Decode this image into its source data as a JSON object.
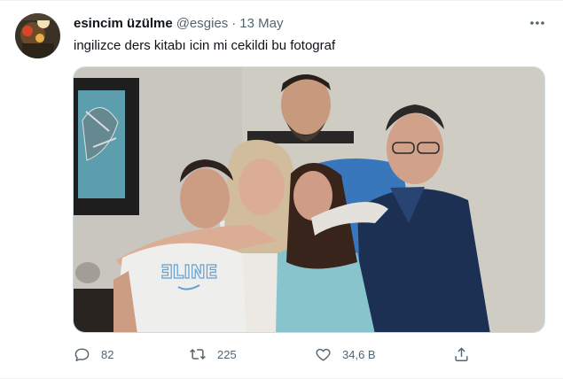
{
  "tweet": {
    "display_name": "esincim üzülme",
    "handle": "@esgies",
    "separator": "·",
    "time": "13 May",
    "text": "ingilizce ders kitabı icin mi cekildi bu fotograf"
  },
  "actions": {
    "reply_count": "82",
    "retweet_count": "225",
    "like_count": "34,6 B"
  },
  "icons": {
    "more": "more-horizontal-icon",
    "reply": "reply-icon",
    "retweet": "retweet-icon",
    "like": "heart-icon",
    "share": "share-icon"
  },
  "media": {
    "tshirt_text": "ƎLINE"
  },
  "colors": {
    "text_primary": "#0f1419",
    "text_secondary": "#536471",
    "border": "#cfd9de"
  }
}
